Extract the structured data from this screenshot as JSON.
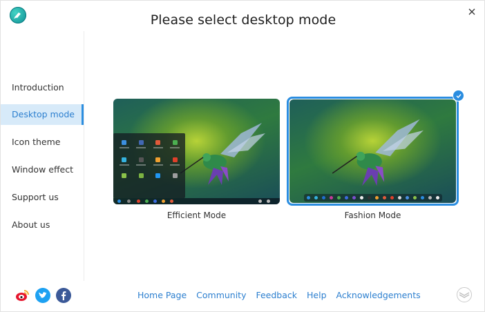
{
  "window": {
    "title": "Please select desktop mode"
  },
  "sidebar": {
    "items": [
      {
        "label": "Introduction",
        "active": false
      },
      {
        "label": "Desktop mode",
        "active": true
      },
      {
        "label": "Icon theme",
        "active": false
      },
      {
        "label": "Window effect",
        "active": false
      },
      {
        "label": "Support us",
        "active": false
      },
      {
        "label": "About us",
        "active": false
      }
    ]
  },
  "modes": [
    {
      "label": "Efficient Mode",
      "selected": false
    },
    {
      "label": "Fashion Mode",
      "selected": true
    }
  ],
  "footer": {
    "links": [
      "Home Page",
      "Community",
      "Feedback",
      "Help",
      "Acknowledgements"
    ],
    "social": [
      "weibo-icon",
      "twitter-icon",
      "facebook-icon"
    ]
  },
  "colors": {
    "accent": "#2c8ee0",
    "sidebar_active_bg": "#d7eaf9",
    "link": "#2c7fcf"
  }
}
